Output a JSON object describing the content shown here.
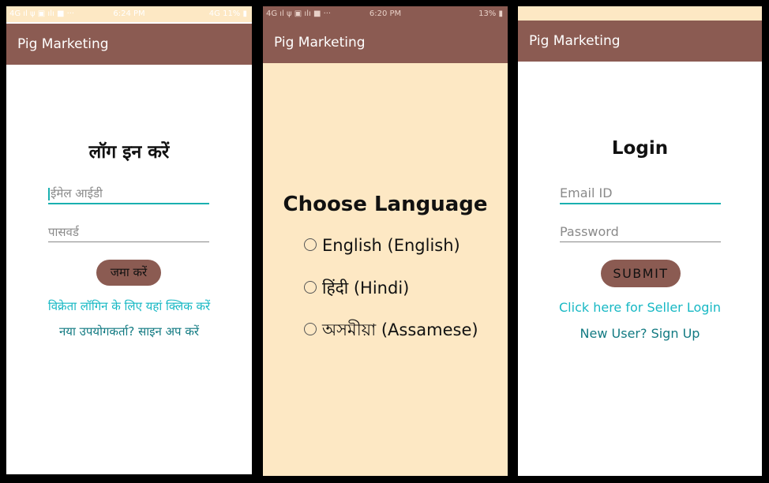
{
  "screens": [
    {
      "status": {
        "left": "4G ıl ψ ▣ ılı ■ ···",
        "time": "6:24 PM",
        "right": "4G 11% ▮"
      },
      "app_title": "Pig Marketing",
      "title": "लॉग इन करें",
      "email_placeholder": "ईमेल आईडी",
      "password_placeholder": "पासवर्ड",
      "submit_label": "जमा करें",
      "seller_link": "विक्रेता लॉगिन के लिए यहां क्लिक करें",
      "signup_link": "नया उपयोगकर्ता? साइन अप करें"
    },
    {
      "status": {
        "left": "4G ıl ψ ▣ ılı ■ ···",
        "time": "6:20 PM",
        "right": "13% ▮"
      },
      "app_title": "Pig Marketing",
      "title": "Choose Language",
      "options": [
        "English (English)",
        "हिंदी (Hindi)",
        "অসমীয়া (Assamese)"
      ]
    },
    {
      "app_title": "Pig Marketing",
      "title": "Login",
      "email_placeholder": "Email ID",
      "password_placeholder": "Password",
      "submit_label": "SUBMIT",
      "seller_link": "Click here for Seller Login",
      "signup_link": "New User? Sign Up"
    }
  ],
  "colors": {
    "appbar": "#8b5b52",
    "accent_cyan": "#17b8c4",
    "link_teal": "#127a82",
    "cream_background": "#fde8c4"
  },
  "icons": [
    "radio-unchecked-icon",
    "text-cursor-icon"
  ]
}
